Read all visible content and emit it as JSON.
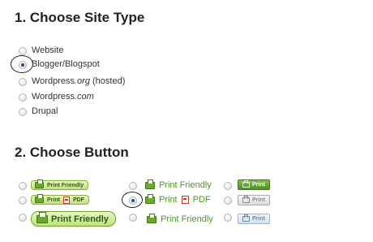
{
  "section1": {
    "heading": "1. Choose Site Type",
    "options": [
      {
        "label": "Website",
        "checked": false
      },
      {
        "label": "Blogger/Blogspot",
        "checked": true
      },
      {
        "prefix": "Wordpress",
        "em": ".org",
        "suffix": " (hosted)",
        "checked": false
      },
      {
        "prefix": "Wordpress",
        "em": ".com",
        "suffix": "",
        "checked": false
      },
      {
        "label": "Drupal",
        "checked": false
      }
    ]
  },
  "section2": {
    "heading": "2. Choose Button",
    "left": [
      {
        "label": "Print Friendly",
        "checked": false
      },
      {
        "label": "Print",
        "pdf": "PDF",
        "checked": false
      },
      {
        "label": "Print Friendly",
        "checked": false
      }
    ],
    "middle": [
      {
        "label": "Print Friendly",
        "checked": false
      },
      {
        "label": "Print",
        "pdf": "PDF",
        "checked": true
      },
      {
        "label": "Print Friendly",
        "checked": false
      }
    ],
    "right": [
      {
        "label": "Print",
        "style": "green",
        "checked": false
      },
      {
        "label": "Print",
        "style": "gray",
        "checked": false
      },
      {
        "label": "Print",
        "style": "blue",
        "checked": false
      }
    ]
  },
  "colors": {
    "accent_green": "#4a9a1c",
    "pill_green": "#bfe27a",
    "radio_selected": "#1f4d8a"
  }
}
